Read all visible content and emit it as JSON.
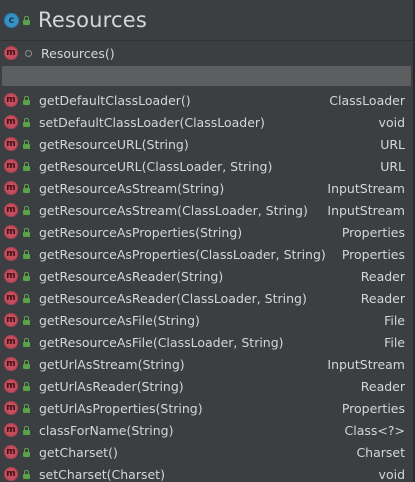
{
  "header": {
    "title": "Resources",
    "class_icon_letter": "c",
    "class_icon_color": "#3592c4"
  },
  "constructor": {
    "icon_letter": "m",
    "name": "Resources()"
  },
  "method_icon": {
    "letter": "m",
    "color": "#c34e5c"
  },
  "methods": [
    {
      "name": "getDefaultClassLoader()",
      "type": "ClassLoader"
    },
    {
      "name": "setDefaultClassLoader(ClassLoader)",
      "type": "void"
    },
    {
      "name": "getResourceURL(String)",
      "type": "URL"
    },
    {
      "name": "getResourceURL(ClassLoader, String)",
      "type": "URL"
    },
    {
      "name": "getResourceAsStream(String)",
      "type": "InputStream"
    },
    {
      "name": "getResourceAsStream(ClassLoader, String)",
      "type": "InputStream"
    },
    {
      "name": "getResourceAsProperties(String)",
      "type": "Properties"
    },
    {
      "name": "getResourceAsProperties(ClassLoader, String)",
      "type": "Properties"
    },
    {
      "name": "getResourceAsReader(String)",
      "type": "Reader"
    },
    {
      "name": "getResourceAsReader(ClassLoader, String)",
      "type": "Reader"
    },
    {
      "name": "getResourceAsFile(String)",
      "type": "File"
    },
    {
      "name": "getResourceAsFile(ClassLoader, String)",
      "type": "File"
    },
    {
      "name": "getUrlAsStream(String)",
      "type": "InputStream"
    },
    {
      "name": "getUrlAsReader(String)",
      "type": "Reader"
    },
    {
      "name": "getUrlAsProperties(String)",
      "type": "Properties"
    },
    {
      "name": "classForName(String)",
      "type": "Class<?>"
    },
    {
      "name": "getCharset()",
      "type": "Charset"
    },
    {
      "name": "setCharset(Charset)",
      "type": "void"
    }
  ]
}
